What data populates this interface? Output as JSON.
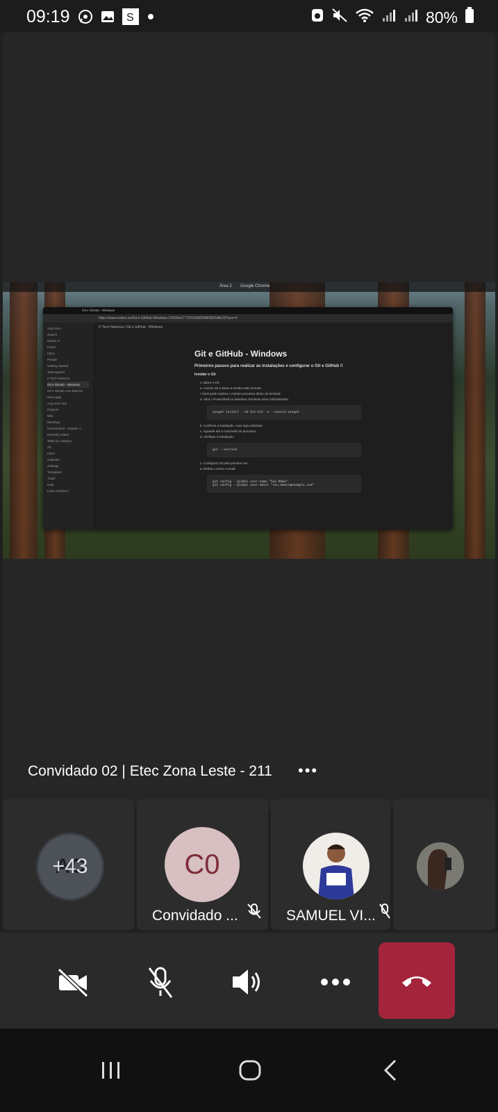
{
  "status_bar": {
    "time": "09:19",
    "left_icons": [
      "whatsapp-icon",
      "gallery-icon",
      "s-app-icon",
      "dot-icon"
    ],
    "right_icons": [
      "recycle-icon",
      "mute-icon",
      "wifi-icon",
      "signal-icon",
      "signal-icon",
      "battery-icon"
    ],
    "battery": "80%"
  },
  "shared_screen": {
    "topbar_items": [
      "Área 2",
      "Google Chrome"
    ],
    "browser_tab": "Git e GitHub - Windows",
    "url": "https://www.notion.so/Git-e-GitHub-Windows-1241fee27710180d982b8f3826d8c02?pvs=4",
    "breadcrumb": "P-Tech Nobreza  /  Git e GitHub - Windows",
    "sidebar_items": [
      "Ang Uuxo",
      "Search",
      "Notion AI",
      "Home",
      "Inbox",
      "Private",
      "Getting Started",
      "Teamspaces",
      "P-Tech Nobreza",
      "Git e GitHub - Windows",
      "Git e GitHub com Mac/Os",
      "New page",
      "Ang Uuxo HQ",
      "Projects",
      "Wiki",
      "Meetings",
      "Documentos - Angular J...",
      "Recently edited",
      "Table by category",
      "All",
      "Inbox",
      "Calendar",
      "Settings",
      "Templates",
      "Trash",
      "Help",
      "Invite members"
    ],
    "doc_title": "Git e GitHub - Windows",
    "doc_subtitle": "Primeiros passos para realizar as instalações e configurar o Git e GitHub !!",
    "doc_section": "Instalar o Git",
    "doc_lines": [
      "1. Baixe o Git:",
      "a. Acesse Git e baixe a versão mais recente.",
      "• Você pode realizar o mesmo processo direto do terminal:",
      "a. Abra o PowerShell ou Windows Terminal como Administrador."
    ],
    "code1": "winget install --id Git.Git -e --source winget",
    "doc_lines2": [
      "b. Confirme a instalação, caso seja solicitado.",
      "c. Aguarde até a conclusão do processo.",
      "d. Verifique a instalação:"
    ],
    "code2": "git --version",
    "doc_lines3": [
      "2. Configurar Git pela primeira vez:",
      "a. Defina o nome e email:"
    ],
    "code3a": "git config --global user.name \"Seu Nome\"",
    "code3b": "git config --global user.email \"seu.email@exemplo.com\""
  },
  "presenter": {
    "caption": "Convidado 02 | Etec Zona Leste - 211",
    "more_label": "•••"
  },
  "participants": [
    {
      "initials": "AC",
      "overflow_count": "+43"
    },
    {
      "initials": "C0",
      "name": "Convidado ...",
      "muted": true,
      "color": "#d8bfc1"
    },
    {
      "name": "SAMUEL VI...",
      "muted": true
    },
    {
      "name": ""
    }
  ],
  "controls": {
    "camera": "camera-off-icon",
    "mic": "mic-off-icon",
    "speaker": "speaker-icon",
    "more": "more-icon",
    "hangup": "hangup-icon",
    "hangup_color": "#a4243b"
  },
  "nav": [
    "recents-icon",
    "home-icon",
    "back-icon"
  ]
}
